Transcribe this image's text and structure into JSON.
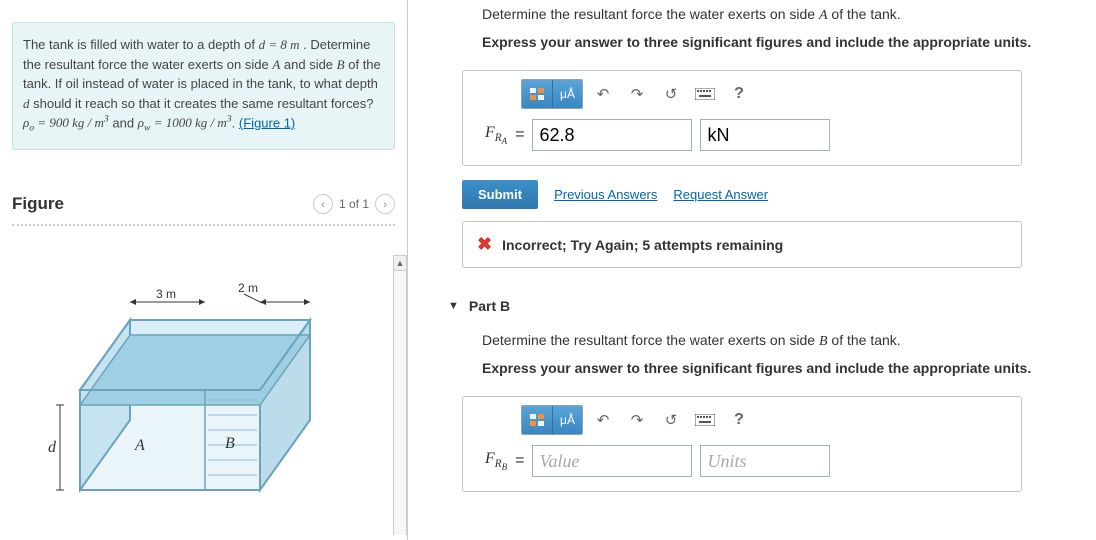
{
  "problem": {
    "text_prefix": "The tank is filled with water to a depth of ",
    "d_expr": "d = 8 m",
    "text_mid1": " . Determine the resultant force the water exerts on side ",
    "side1": "A",
    "text_mid2": " and side ",
    "side2": "B",
    "text_mid3": " of the tank. If oil instead of water is placed in the tank, to what depth ",
    "d_var": "d",
    "text_mid4": " should it reach so that it creates the same resultant forces? ",
    "rho_o": "ρₒ = 900 kg / m³",
    "and": " and ",
    "rho_w": "ρ_w = 1000 kg / m³",
    "figure_link": "(Figure 1)"
  },
  "figure": {
    "title": "Figure",
    "pager": "1 of 1",
    "dim_a": "3 m",
    "dim_b": "2 m",
    "label_a": "A",
    "label_b": "B",
    "label_d": "d"
  },
  "partA": {
    "prompt": "Determine the resultant force the water exerts on side A of the tank.",
    "instr": "Express your answer to three significant figures and include the appropriate units.",
    "lhs_html": "F<sub>R<sub>A</sub></sub>",
    "value": "62.8",
    "units": "kN",
    "submit": "Submit",
    "prev": "Previous Answers",
    "req": "Request Answer",
    "feedback": "Incorrect; Try Again; 5 attempts remaining"
  },
  "partB": {
    "header": "Part B",
    "prompt": "Determine the resultant force the water exerts on side B of the tank.",
    "instr": "Express your answer to three significant figures and include the appropriate units.",
    "lhs_html": "F<sub>R<sub>B</sub></sub>",
    "value_ph": "Value",
    "units_ph": "Units"
  },
  "toolbar": {
    "templates_icon": "tmpl",
    "ua_label": "μÅ",
    "undo": "↶",
    "redo": "↷",
    "reset": "↺",
    "help": "?"
  },
  "chart_data": {
    "type": "diagram",
    "tank_width_m": 3,
    "tank_depth_m": 2,
    "water_depth_symbol": "d",
    "water_depth_value_m": 8,
    "faces": [
      "A",
      "B"
    ]
  }
}
